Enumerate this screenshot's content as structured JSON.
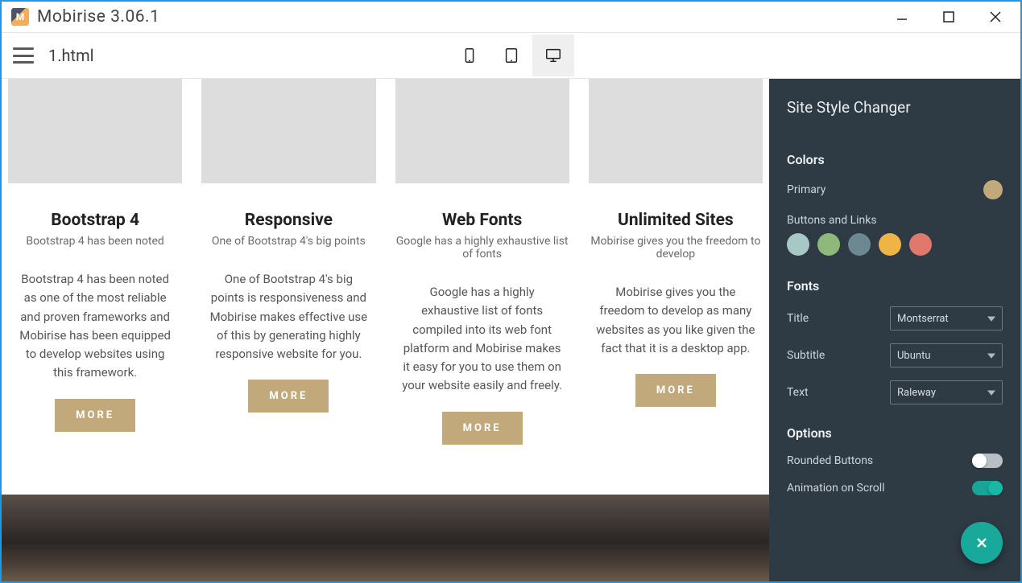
{
  "window": {
    "title": "Mobirise 3.06.1"
  },
  "toolbar": {
    "filename": "1.html"
  },
  "cards": [
    {
      "title": "Bootstrap 4",
      "subtitle": "Bootstrap 4 has been noted",
      "desc": "Bootstrap 4 has been noted as one of the most reliable and proven frameworks and Mobirise has been equipped to develop websites using this framework.",
      "more": "MORE"
    },
    {
      "title": "Responsive",
      "subtitle": "One of Bootstrap 4's big points",
      "desc": "One of Bootstrap 4's big points is responsiveness and Mobirise makes effective use of this by generating highly responsive website for you.",
      "more": "MORE"
    },
    {
      "title": "Web Fonts",
      "subtitle": "Google has a highly exhaustive list of fonts",
      "desc": "Google has a highly exhaustive list of fonts compiled into its web font platform and Mobirise makes it easy for you to use them on your website easily and freely.",
      "more": "MORE"
    },
    {
      "title": "Unlimited Sites",
      "subtitle": "Mobirise gives you the freedom to develop",
      "desc": "Mobirise gives you the freedom to develop as many websites as you like given the fact that it is a desktop app.",
      "more": "MORE"
    }
  ],
  "panel": {
    "title": "Site Style Changer",
    "colors": {
      "section": "Colors",
      "primary_label": "Primary",
      "primary_value": "#c1a97c",
      "buttons_label": "Buttons and Links",
      "buttons_values": [
        "#a7c8c4",
        "#8fb97a",
        "#6b8893",
        "#eeb544",
        "#e0786b"
      ]
    },
    "fonts": {
      "section": "Fonts",
      "title_label": "Title",
      "title_value": "Montserrat",
      "subtitle_label": "Subtitle",
      "subtitle_value": "Ubuntu",
      "text_label": "Text",
      "text_value": "Raleway"
    },
    "options": {
      "section": "Options",
      "rounded_label": "Rounded Buttons",
      "rounded_value": false,
      "anim_label": "Animation on Scroll",
      "anim_value": true
    }
  }
}
